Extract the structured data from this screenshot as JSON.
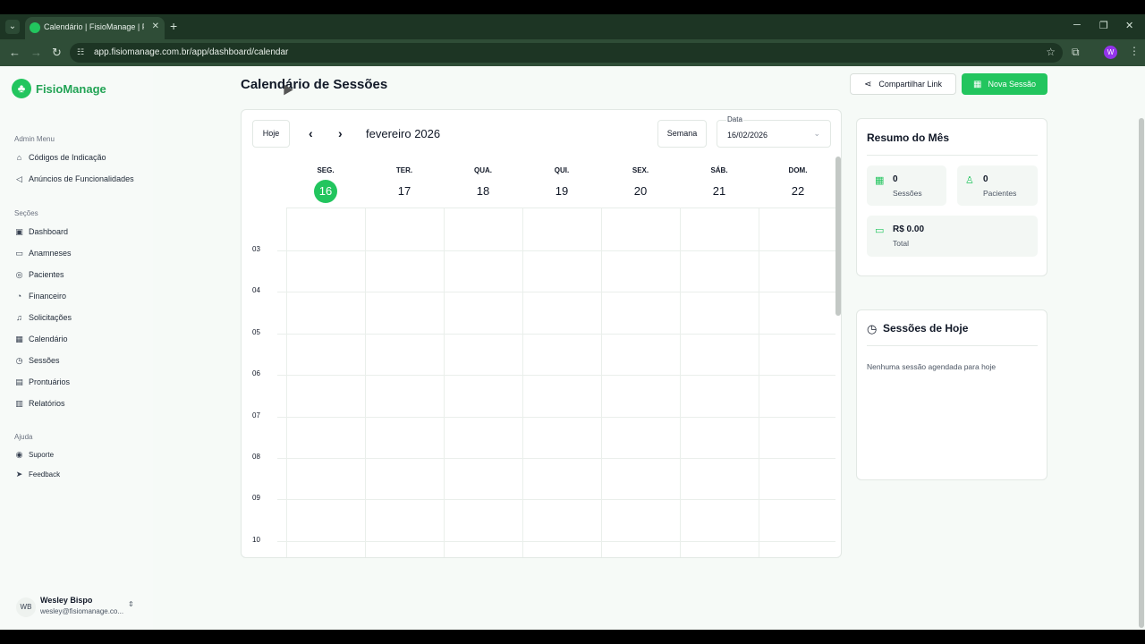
{
  "browser": {
    "tab_title": "Calendário | FisioManage | Fisio",
    "url": "app.fisiomanage.com.br/app/dashboard/calendar",
    "profile_initial": "W"
  },
  "sidebar": {
    "brand": "FisioManage",
    "admin_title": "Admin Menu",
    "admin_items": [
      {
        "label": "Códigos de Indicação",
        "icon": "tag-icon"
      },
      {
        "label": "Anúncios de Funcionalidades",
        "icon": "megaphone-icon"
      }
    ],
    "sections_title": "Seções",
    "section_items": [
      {
        "label": "Dashboard",
        "icon": "dashboard-icon"
      },
      {
        "label": "Anamneses",
        "icon": "book-icon"
      },
      {
        "label": "Pacientes",
        "icon": "user-circle-icon"
      },
      {
        "label": "Financeiro",
        "icon": "pie-icon"
      },
      {
        "label": "Solicitações",
        "icon": "bell-icon"
      },
      {
        "label": "Calendário",
        "icon": "calendar-icon"
      },
      {
        "label": "Sessões",
        "icon": "sessions-icon"
      },
      {
        "label": "Prontuários",
        "icon": "clipboard-icon"
      },
      {
        "label": "Relatórios",
        "icon": "report-icon"
      }
    ],
    "help_title": "Ajuda",
    "help_items": [
      {
        "label": "Suporte",
        "icon": "support-icon"
      },
      {
        "label": "Feedback",
        "icon": "send-icon"
      }
    ],
    "user": {
      "initials": "WB",
      "name": "Wesley Bispo",
      "email": "wesley@fisiomanage.co..."
    }
  },
  "header": {
    "title": "Calendário de Sessões",
    "share_label": "Compartilhar Link",
    "new_session_label": "Nova Sessão"
  },
  "calendar": {
    "today_label": "Hoje",
    "month": "fevereiro 2026",
    "view_label": "Semana",
    "date_label": "Data",
    "date_value": "16/02/2026",
    "days": [
      {
        "name": "SEG.",
        "num": "16",
        "today": true
      },
      {
        "name": "TER.",
        "num": "17"
      },
      {
        "name": "QUA.",
        "num": "18"
      },
      {
        "name": "QUI.",
        "num": "19"
      },
      {
        "name": "SEX.",
        "num": "20"
      },
      {
        "name": "SÁB.",
        "num": "21"
      },
      {
        "name": "DOM.",
        "num": "22"
      }
    ],
    "hours": [
      "03",
      "04",
      "05",
      "06",
      "07",
      "08",
      "09",
      "10"
    ]
  },
  "summary": {
    "title": "Resumo do Mês",
    "sessions_value": "0",
    "sessions_label": "Sessões",
    "patients_value": "0",
    "patients_label": "Pacientes",
    "total_value": "R$ 0.00",
    "total_label": "Total"
  },
  "today_sessions": {
    "title": "Sessões de Hoje",
    "empty": "Nenhuma sessão agendada para hoje"
  },
  "colors": {
    "accent": "#22c55e",
    "brand_text": "#22a355"
  }
}
